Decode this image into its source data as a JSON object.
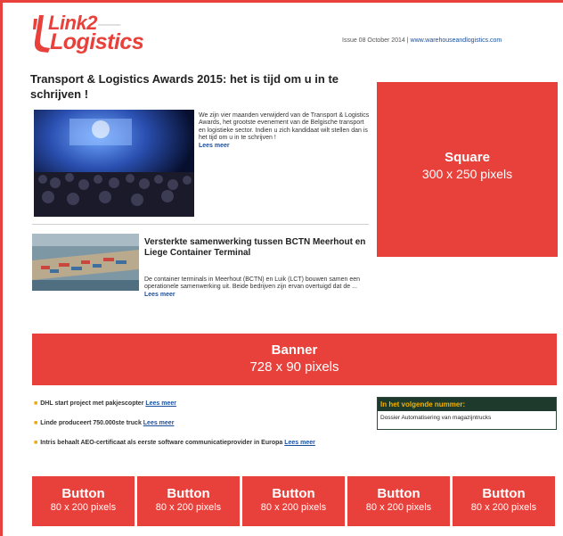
{
  "header": {
    "logo_line1": "Link2",
    "logo_line2": "Logistics",
    "issue_text": "Issue 08 October 2014 | ",
    "site_link": "www.warehouseandlogistics.com"
  },
  "headline": "Transport & Logistics Awards 2015: het is tijd om u in te schrijven !",
  "article1": {
    "body": "We zijn vier maanden verwijderd van de Transport & Logistics Awards, het grootste evenement van de Belgische transport en logistieke sector. Indien u zich kandidaat wilt stellen dan is het tijd om u in te schrijven !",
    "more": "Lees meer"
  },
  "article2": {
    "title": "Versterkte samenwerking tussen BCTN Meerhout en Liege Container Terminal",
    "body": "De container terminals in Meerhout (BCTN) en Luik (LCT) bouwen samen een operationele samenwerking uit. Beide bedrijven zijn ervan overtuigd dat de ...",
    "more": "Lees meer"
  },
  "ads": {
    "square": {
      "label": "Square",
      "size": "300 x 250 pixels"
    },
    "banner": {
      "label": "Banner",
      "size": "728 x 90 pixels"
    },
    "buttons": [
      {
        "label": "Button",
        "size": "80 x 200 pixels"
      },
      {
        "label": "Button",
        "size": "80 x 200 pixels"
      },
      {
        "label": "Button",
        "size": "80 x 200 pixels"
      },
      {
        "label": "Button",
        "size": "80 x 200 pixels"
      },
      {
        "label": "Button",
        "size": "80 x 200 pixels"
      }
    ]
  },
  "news_list": [
    {
      "text": "DHL start project met pakjescopter ",
      "link": "Lees meer"
    },
    {
      "text": "Linde produceert 750.000ste truck ",
      "link": "Lees meer"
    },
    {
      "text": "Intris behaalt AEO-certificaat als eerste software communicatieprovider in Europa ",
      "link": "Lees meer"
    }
  ],
  "next_issue": {
    "heading": "In het volgende nummer:",
    "item": "Dossier Automatisering van magazijntrucks"
  },
  "colors": {
    "accent": "#e8413b",
    "link": "#1a4e9a",
    "bullet": "#f0a500",
    "box_header": "#1e3a2c",
    "box_header_text": "#f2b300"
  }
}
